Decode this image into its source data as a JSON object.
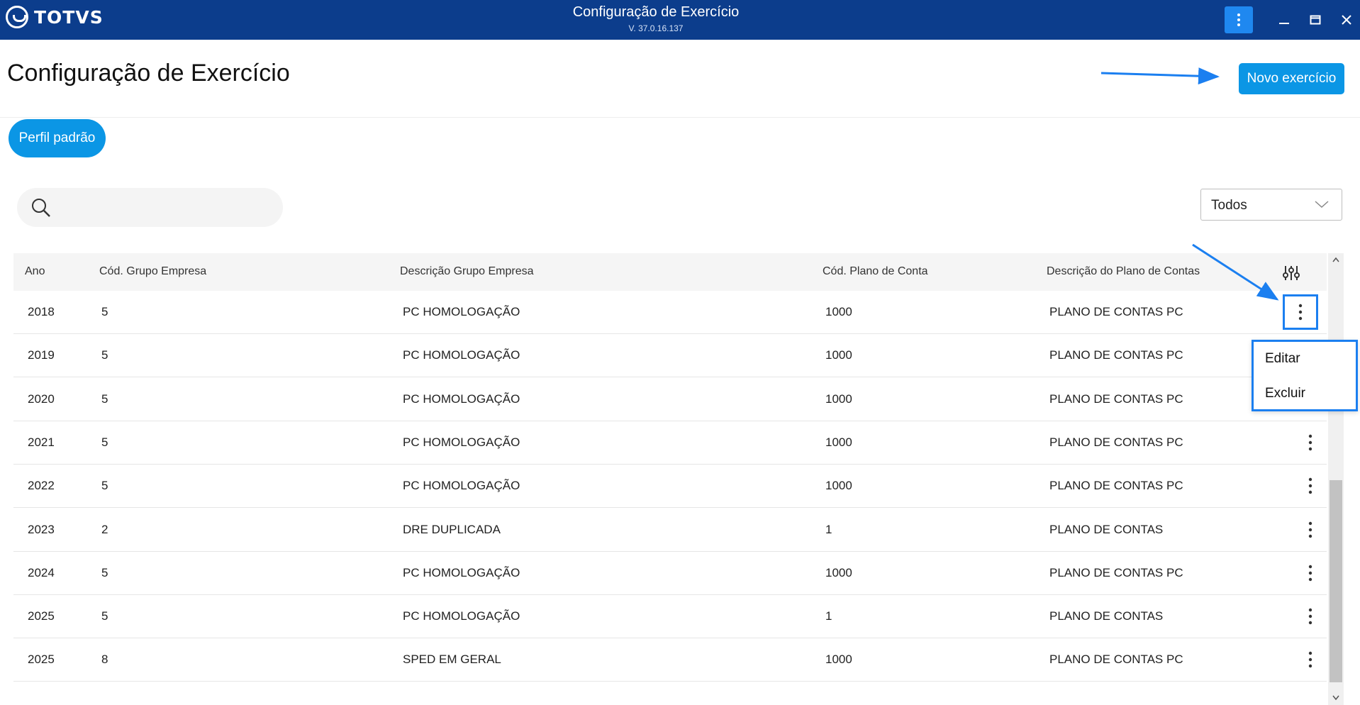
{
  "window": {
    "brand": "TOTVS",
    "title": "Configuração de Exercício",
    "version": "V. 37.0.16.137"
  },
  "page": {
    "title": "Configuração de Exercício",
    "new_button": "Novo exercício",
    "profile_button": "Perfil padrão"
  },
  "search": {
    "placeholder": "",
    "value": ""
  },
  "filter": {
    "selected": "Todos"
  },
  "table": {
    "columns": [
      "Ano",
      "Cód. Grupo Empresa",
      "Descrição Grupo Empresa",
      "Cód. Plano de Conta",
      "Descrição do Plano de Contas"
    ],
    "rows": [
      [
        "2018",
        "5",
        "PC HOMOLOGAÇÃO",
        "1000",
        "PLANO DE CONTAS PC"
      ],
      [
        "2019",
        "5",
        "PC HOMOLOGAÇÃO",
        "1000",
        "PLANO DE CONTAS PC"
      ],
      [
        "2020",
        "5",
        "PC HOMOLOGAÇÃO",
        "1000",
        "PLANO DE CONTAS PC"
      ],
      [
        "2021",
        "5",
        "PC HOMOLOGAÇÃO",
        "1000",
        "PLANO DE CONTAS PC"
      ],
      [
        "2022",
        "5",
        "PC HOMOLOGAÇÃO",
        "1000",
        "PLANO DE CONTAS PC"
      ],
      [
        "2023",
        "2",
        "DRE DUPLICADA",
        "1",
        "PLANO DE CONTAS"
      ],
      [
        "2024",
        "5",
        "PC HOMOLOGAÇÃO",
        "1000",
        "PLANO DE CONTAS PC"
      ],
      [
        "2025",
        "5",
        "PC HOMOLOGAÇÃO",
        "1",
        "PLANO DE CONTAS"
      ],
      [
        "2025",
        "8",
        "SPED EM GERAL",
        "1000",
        "PLANO DE CONTAS PC"
      ]
    ]
  },
  "row_menu": {
    "items": [
      "Editar",
      "Excluir"
    ]
  },
  "colors": {
    "titlebar": "#0c3d8c",
    "primary": "#0b96e5",
    "annotation": "#1b7ff0"
  }
}
